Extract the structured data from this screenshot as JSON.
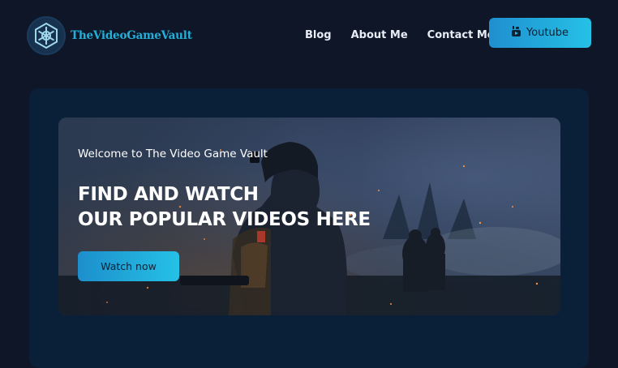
{
  "header": {
    "brand": "TheVideoGameVault",
    "nav": [
      "Blog",
      "About Me",
      "Contact Me"
    ],
    "youtube_label": "Youtube"
  },
  "hero": {
    "subtitle": "Welcome to The Video Game Vault",
    "title_line1": "FIND AND WATCH",
    "title_line2": "OUR POPULAR VIDEOS HERE",
    "button_label": "Watch now"
  },
  "colors": {
    "background": "#0e1628",
    "card": "#0a1f38",
    "accent": "#25c1e6"
  }
}
